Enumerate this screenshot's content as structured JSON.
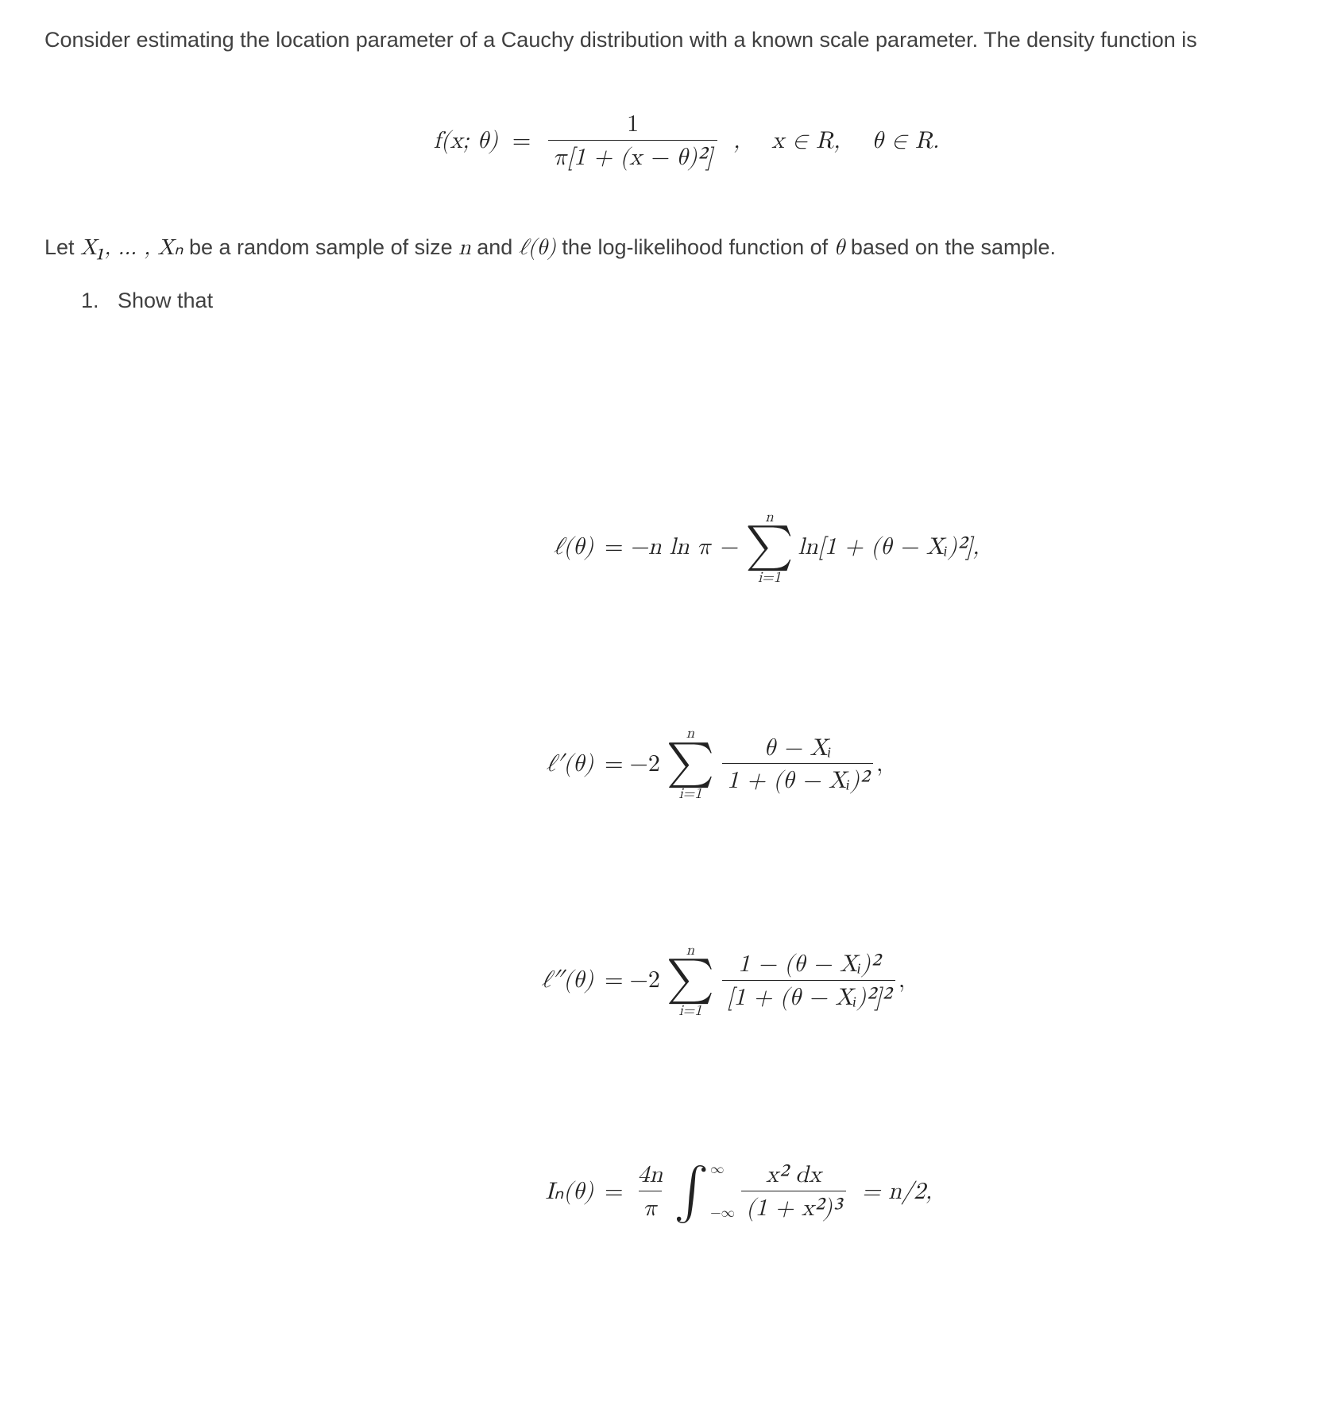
{
  "intro": {
    "p1_a": "Consider estimating the location parameter of a Cauchy distribution with a known scale parameter. The density function is",
    "p2_a": "Let ",
    "p2_b": " be a random sample of size ",
    "p2_c": " and ",
    "p2_d": " the log-likelihood function of ",
    "p2_e": " based on the sample."
  },
  "list": {
    "item1": "Show that"
  },
  "math": {
    "sample": "X₁, … , Xₙ",
    "n": "n",
    "ell_theta": "ℓ(θ)",
    "theta": "θ",
    "density_lhs": "f(x; θ)",
    "density_num": "1",
    "density_den": "π[1 + (x − θ)²]",
    "density_tail": ",    x ∈ R,    θ ∈ R.",
    "r1_lhs": "ℓ(θ)",
    "r1_pre": "−n ln π −",
    "r1_sum_top": "n",
    "r1_sum_bot": "i=1",
    "r1_post": "ln[1 + (θ − Xᵢ)²],",
    "r2_lhs": "ℓ′(θ)",
    "r2_pre": "−2",
    "r2_sum_top": "n",
    "r2_sum_bot": "i=1",
    "r2_num": "θ − Xᵢ",
    "r2_den": "1 + (θ − Xᵢ)²",
    "r2_tail": ",",
    "r3_lhs": "ℓ″(θ)",
    "r3_pre": "−2",
    "r3_sum_top": "n",
    "r3_sum_bot": "i=1",
    "r3_num": "1 − (θ − Xᵢ)²",
    "r3_den": "[1 + (θ − Xᵢ)²]²",
    "r3_tail": ",",
    "r4_lhs": "Iₙ(θ)",
    "r4_coef_num": "4n",
    "r4_coef_den": "π",
    "r4_int_up": "∞",
    "r4_int_lo": "−∞",
    "r4_num": "x² dx",
    "r4_den": "(1 + x²)³",
    "r4_tail": " = n/2,"
  }
}
